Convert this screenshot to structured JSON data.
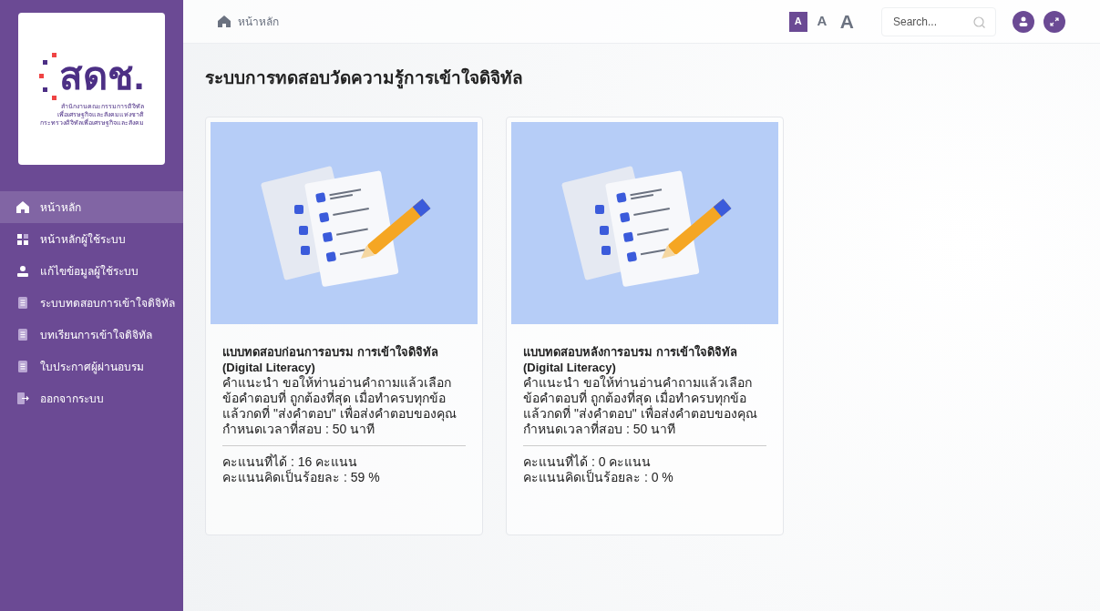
{
  "logo": {
    "mark": "สดช.",
    "caption_lines": [
      "สำนักงานคณะกรรมการดิจิทัล",
      "เพื่อเศรษฐกิจและสังคมแห่งชาติ",
      "กระทรวงดิจิทัลเพื่อเศรษฐกิจและสังคม"
    ]
  },
  "sidebar": {
    "items": [
      {
        "label": "หน้าหลัก",
        "kind": "home",
        "selected": true
      },
      {
        "label": "หน้าหลักผู้ใช้ระบบ",
        "kind": "grid",
        "selected": false
      },
      {
        "label": "แก้ไขข้อมูลผู้ใช้ระบบ",
        "kind": "user",
        "selected": false
      },
      {
        "label": "ระบบทดสอบการเข้าใจดิจิทัล",
        "kind": "doc",
        "selected": false
      },
      {
        "label": "บทเรียนการเข้าใจดิจิทัล",
        "kind": "doc",
        "selected": false
      },
      {
        "label": "ใบประกาศผู้ผ่านอบรม",
        "kind": "doc",
        "selected": false
      },
      {
        "label": "ออกจากระบบ",
        "kind": "logout",
        "selected": false
      }
    ]
  },
  "breadcrumb": "หน้าหลัก",
  "font_size_buttons": [
    {
      "label": "A",
      "selected": true
    },
    {
      "label": "A",
      "selected": false
    },
    {
      "label": "A",
      "selected": false
    }
  ],
  "search": {
    "placeholder": "Search..."
  },
  "page_title": "ระบบการทดสอบวัดความรู้การเข้าใจดิจิทัล",
  "cards": [
    {
      "title": "แบบทดสอบก่อนการอบรม การเข้าใจดิจิทัล (Digital Literacy)",
      "instructions": "คำแนะนำ ขอให้ท่านอ่านคำถามแล้วเลือกข้อคำตอบที่ ถูกต้องที่สุด เมื่อทำครบทุกข้อแล้วกดที่ \"ส่งคำตอบ\" เพื่อส่งคำตอบของคุณ",
      "time_limit": "กำหนดเวลาที่สอบ : 50 นาที",
      "score": "คะแนนที่ได้ : 16 คะแนน",
      "percent": "คะแนนคิดเป็นร้อยละ : 59 %"
    },
    {
      "title": "แบบทดสอบหลังการอบรม การเข้าใจดิจิทัล (Digital Literacy)",
      "instructions": "คำแนะนำ ขอให้ท่านอ่านคำถามแล้วเลือกข้อคำตอบที่ ถูกต้องที่สุด เมื่อทำครบทุกข้อแล้วกดที่ \"ส่งคำตอบ\" เพื่อส่งคำตอบของคุณ",
      "time_limit": "กำหนดเวลาที่สอบ : 50 นาที",
      "score": "คะแนนที่ได้ : 0 คะแนน",
      "percent": "คะแนนคิดเป็นร้อยละ : 0 %"
    }
  ]
}
